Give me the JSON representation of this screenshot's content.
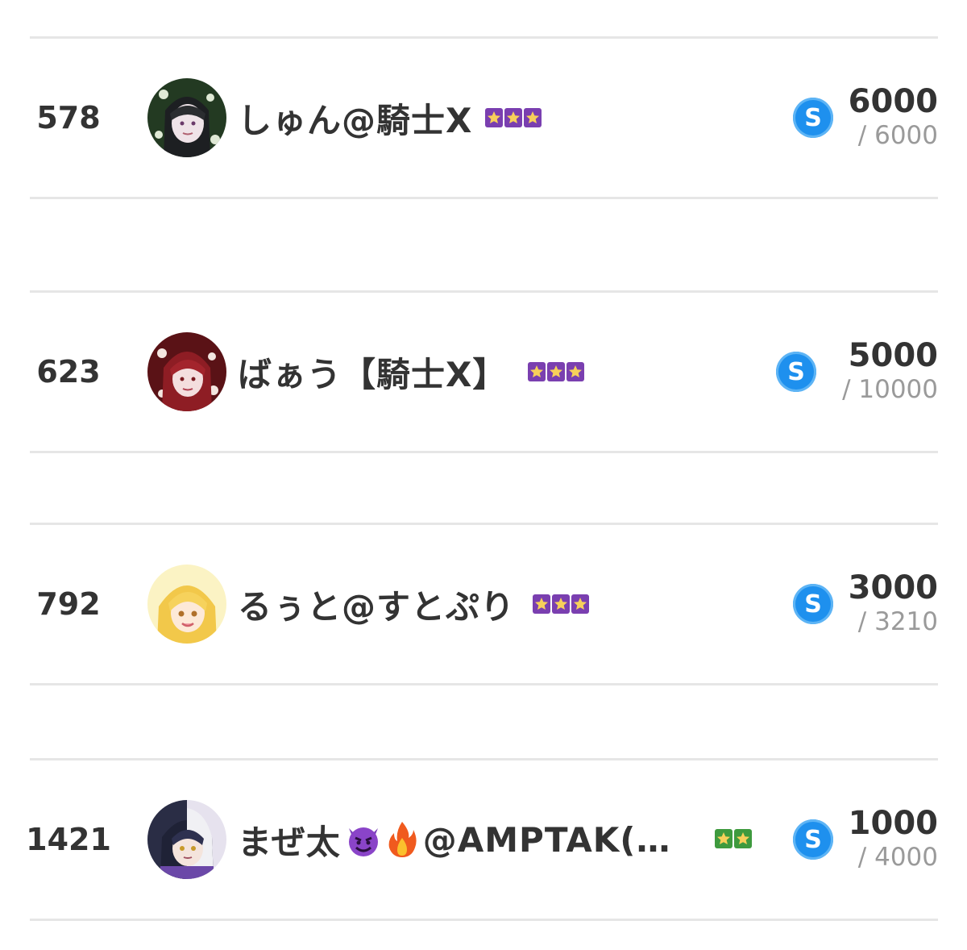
{
  "rows": [
    {
      "rank": "578",
      "name": "しゅん@騎士X",
      "badge_stars": 3,
      "badge_color": "#7a3fb0",
      "currency_symbol": "S",
      "amount": "6000",
      "goal": "/ 6000",
      "avatar_colors": [
        "#2f4a2a",
        "#7aa06a",
        "#e8e0e8"
      ]
    },
    {
      "rank": "623",
      "name": "ばぁう【騎士X】",
      "badge_stars": 3,
      "badge_color": "#7a3fb0",
      "currency_symbol": "S",
      "amount": "5000",
      "goal": "/ 10000",
      "avatar_colors": [
        "#8a1e22",
        "#c9404a",
        "#f2dede"
      ]
    },
    {
      "rank": "792",
      "name": "るぅと@すとぷり",
      "badge_stars": 3,
      "badge_color": "#7a3fb0",
      "currency_symbol": "S",
      "amount": "3000",
      "goal": "/ 3210",
      "avatar_colors": [
        "#f4d04a",
        "#f8e8a0",
        "#ffffff"
      ]
    },
    {
      "rank": "1421",
      "name_prefix": "まぜ太",
      "name_suffix": "@AMPTAK(…",
      "emoji_1": "smiling-devil-icon",
      "emoji_2": "fire-icon",
      "badge_stars": 2,
      "badge_color": "#3e9a3e",
      "currency_symbol": "S",
      "amount": "1000",
      "goal": "/ 4000",
      "avatar_colors": [
        "#2a2f4a",
        "#e8e8f0",
        "#9a6fc8"
      ]
    }
  ]
}
